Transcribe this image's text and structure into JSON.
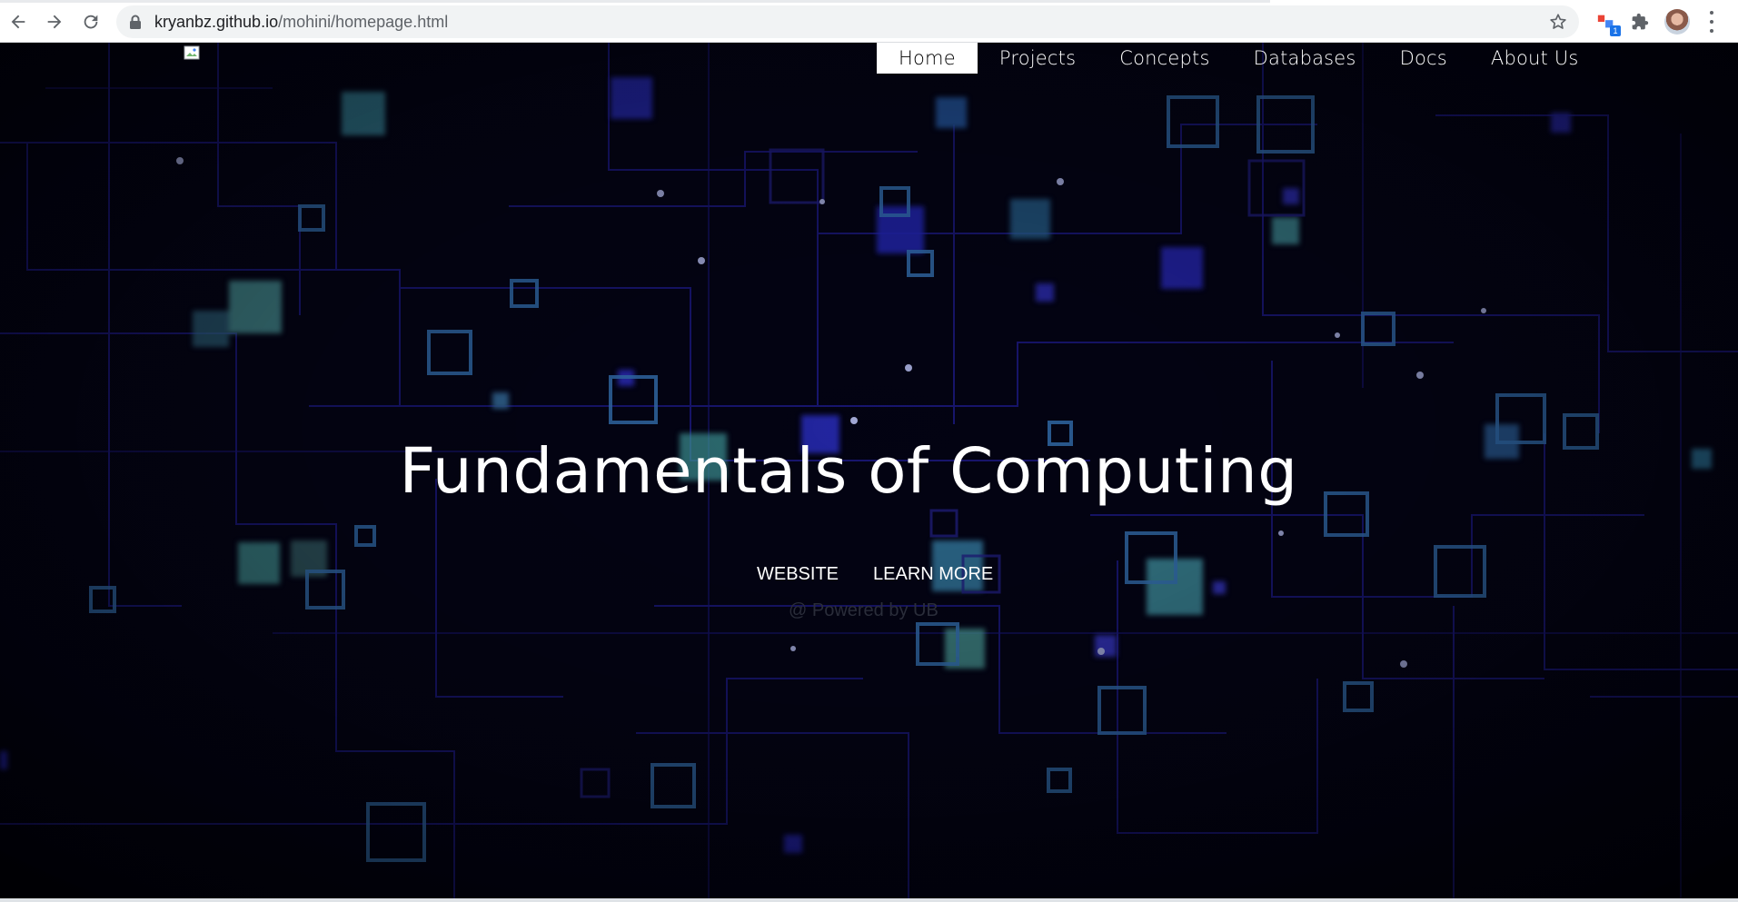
{
  "browser": {
    "url_host": "kryanbz.github.io",
    "url_path": "/mohini/homepage.html",
    "extension_badge": "1",
    "icons": [
      "back-arrow-icon",
      "forward-arrow-icon",
      "reload-icon",
      "lock-icon",
      "bookmark-star-icon",
      "extension-icon",
      "puzzle-icon",
      "profile-avatar",
      "more-menu-icon"
    ]
  },
  "site": {
    "nav": [
      {
        "label": "Home",
        "active": true
      },
      {
        "label": "Projects"
      },
      {
        "label": "Concepts"
      },
      {
        "label": "Databases"
      },
      {
        "label": "Docs"
      },
      {
        "label": "About Us"
      }
    ],
    "hero": {
      "title": "Fundamentals of Computing",
      "links": [
        "WEBSITE",
        "LEARN MORE"
      ],
      "footer": "@ Powered by UB"
    }
  },
  "colors": {
    "background": "#02020a",
    "circuit_blue": "#2a24c8",
    "circuit_cyan": "#5fc4c8"
  }
}
